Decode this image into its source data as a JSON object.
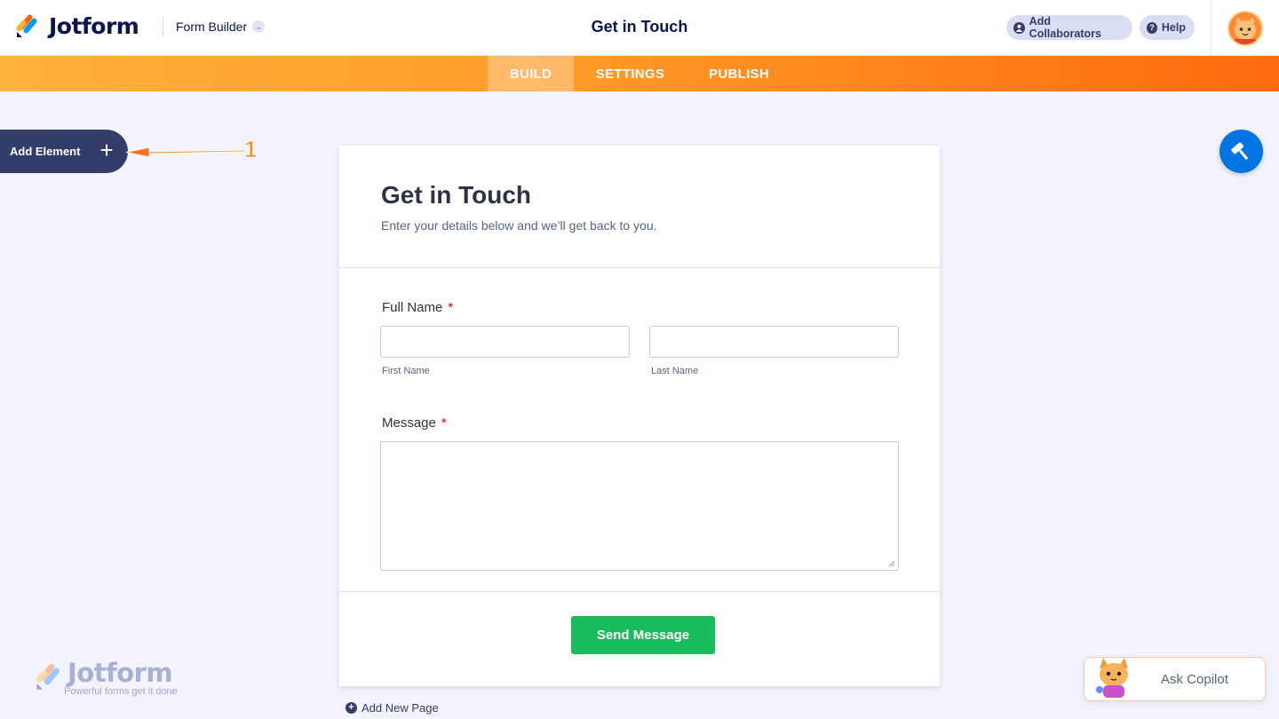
{
  "header": {
    "brand": "Jotform",
    "product_menu": "Form Builder",
    "form_title": "Get in Touch",
    "add_collaborators": "Add Collaborators",
    "help": "Help"
  },
  "nav": {
    "tabs": [
      {
        "label": "BUILD",
        "active": true
      },
      {
        "label": "SETTINGS",
        "active": false
      },
      {
        "label": "PUBLISH",
        "active": false
      }
    ]
  },
  "sidebar": {
    "add_element": "Add Element",
    "annotation_number": "1"
  },
  "form": {
    "title": "Get in Touch",
    "subtitle": "Enter your details below and we’ll get back to you.",
    "full_name": {
      "label": "Full Name",
      "required_mark": "*",
      "first_sublabel": "First Name",
      "last_sublabel": "Last Name",
      "first_value": "",
      "last_value": ""
    },
    "message": {
      "label": "Message",
      "required_mark": "*",
      "value": ""
    },
    "submit_label": "Send Message"
  },
  "footer": {
    "add_new_page": "Add New Page",
    "watermark_brand": "Jotform",
    "watermark_tagline": "Powerful forms get it done",
    "copilot_label": "Ask Copilot"
  },
  "colors": {
    "navy": "#0a1551",
    "orange_start": "#ffb13e",
    "orange_end": "#ff6a10",
    "submit_green": "#18bd5b",
    "paint_blue": "#0075e3",
    "required_red": "#e00000"
  }
}
